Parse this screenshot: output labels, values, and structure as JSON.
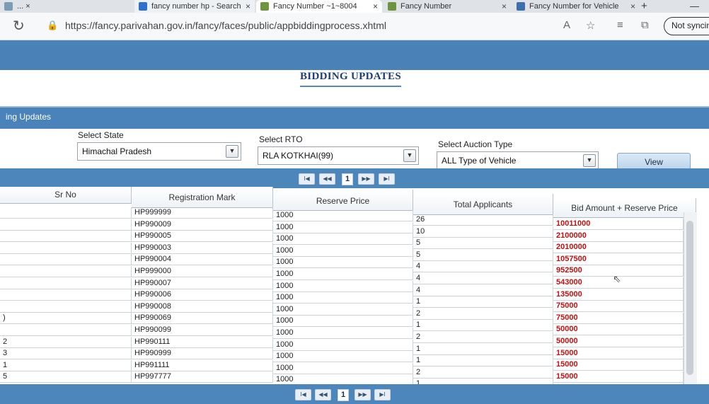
{
  "browser": {
    "tabs": [
      {
        "label": "... ×",
        "color": "#7c9bb8",
        "active": false
      },
      {
        "label": "fancy number hp - Search",
        "color": "#2f6fd0",
        "active": false
      },
      {
        "label": "Fancy Number ~1~8004",
        "color": "#6f9440",
        "active": true
      },
      {
        "label": "Fancy Number",
        "color": "#6f9440",
        "active": false
      },
      {
        "label": "Fancy Number for Vehicle",
        "color": "#3d6fb0",
        "active": false
      }
    ],
    "new_tab": "+",
    "minimize": "—",
    "url": "https://fancy.parivahan.gov.in/fancy/faces/public/appbiddingprocess.xhtml",
    "not_synced": "Not syncing"
  },
  "page": {
    "heading": "BIDDING UPDATES",
    "section_title": "ing Updates"
  },
  "filters": {
    "state_label": "Select State",
    "state_value": "Himachal Pradesh",
    "rto_label": "Select RTO",
    "rto_value": "RLA KOTKHAI(99)",
    "auction_label": "Select Auction Type",
    "auction_value": "ALL Type of Vehicle",
    "view_button": "View"
  },
  "pager": {
    "current_page": "1"
  },
  "table": {
    "columns": [
      "Sr No",
      "Registration Mark",
      "Reserve Price",
      "Total Applicants",
      "Bid Amount + Reserve Price"
    ],
    "rows": [
      {
        "sr": "",
        "reg": "HP999999",
        "reserve": "1000",
        "applicants": "26",
        "bid": "10011000"
      },
      {
        "sr": "",
        "reg": "HP990009",
        "reserve": "1000",
        "applicants": "10",
        "bid": "2100000"
      },
      {
        "sr": "",
        "reg": "HP990005",
        "reserve": "1000",
        "applicants": "5",
        "bid": "2010000"
      },
      {
        "sr": "",
        "reg": "HP990003",
        "reserve": "1000",
        "applicants": "5",
        "bid": "1057500"
      },
      {
        "sr": "",
        "reg": "HP990004",
        "reserve": "1000",
        "applicants": "4",
        "bid": "952500"
      },
      {
        "sr": "",
        "reg": "HP999000",
        "reserve": "1000",
        "applicants": "4",
        "bid": "543000"
      },
      {
        "sr": "",
        "reg": "HP990007",
        "reserve": "1000",
        "applicants": "4",
        "bid": "135000"
      },
      {
        "sr": "",
        "reg": "HP990006",
        "reserve": "1000",
        "applicants": "1",
        "bid": "75000"
      },
      {
        "sr": "",
        "reg": "HP990008",
        "reserve": "1000",
        "applicants": "2",
        "bid": "75000"
      },
      {
        "sr": ")",
        "reg": "HP990069",
        "reserve": "1000",
        "applicants": "1",
        "bid": "50000"
      },
      {
        "sr": "",
        "reg": "HP990099",
        "reserve": "1000",
        "applicants": "2",
        "bid": "50000"
      },
      {
        "sr": "2",
        "reg": "HP990111",
        "reserve": "1000",
        "applicants": "1",
        "bid": "15000"
      },
      {
        "sr": "3",
        "reg": "HP990999",
        "reserve": "1000",
        "applicants": "1",
        "bid": "15000"
      },
      {
        "sr": "1",
        "reg": "HP991111",
        "reserve": "1000",
        "applicants": "2",
        "bid": "15000"
      },
      {
        "sr": "5",
        "reg": "HP997777",
        "reserve": "1000",
        "applicants": "1",
        "bid": "15000"
      }
    ]
  }
}
